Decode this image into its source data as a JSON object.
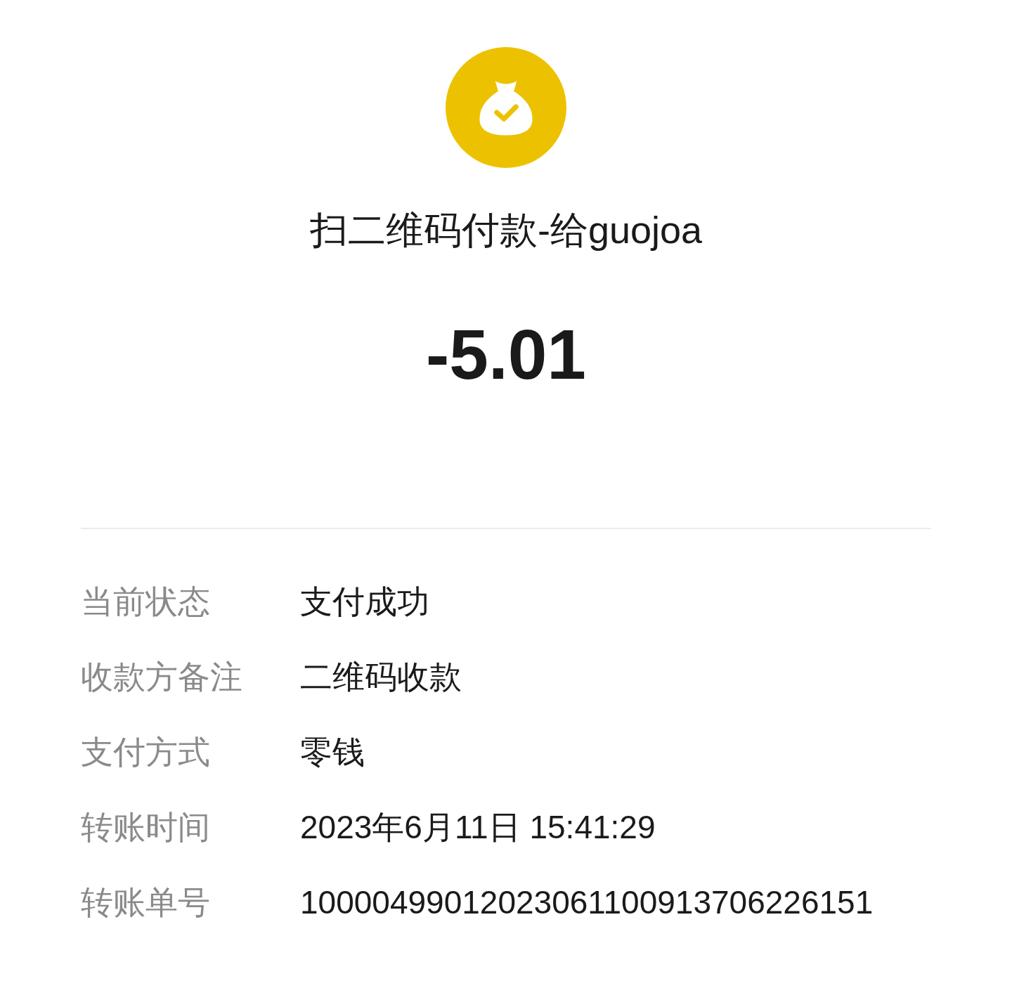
{
  "header": {
    "title": "扫二维码付款-给guojoa",
    "amount": "-5.01"
  },
  "details": [
    {
      "label": "当前状态",
      "value": "支付成功"
    },
    {
      "label": "收款方备注",
      "value": "二维码收款"
    },
    {
      "label": "支付方式",
      "value": "零钱"
    },
    {
      "label": "转账时间",
      "value": "2023年6月11日 15:41:29"
    },
    {
      "label": "转账单号",
      "value": "10000499012023061100913706226151"
    }
  ]
}
